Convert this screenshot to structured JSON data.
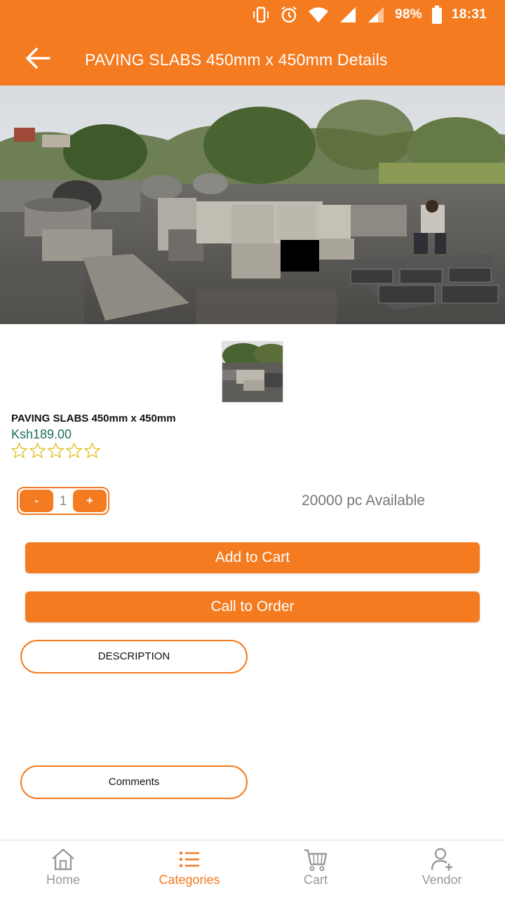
{
  "status_bar": {
    "battery": "98%",
    "time": "18:31"
  },
  "app_bar": {
    "title": "PAVING SLABS 450mm x 450mm Details"
  },
  "product": {
    "name": "PAVING SLABS 450mm x 450mm",
    "price": "Ksh189.00",
    "rating": 0,
    "rating_max": 5
  },
  "quantity": {
    "minus_label": "-",
    "value": "1",
    "plus_label": "+"
  },
  "availability": "20000 pc Available",
  "actions": {
    "add_to_cart": "Add to Cart",
    "call_to_order": "Call to Order",
    "description": "DESCRIPTION",
    "comments": "Comments"
  },
  "bottom_nav": {
    "items": [
      {
        "label": "Home",
        "icon": "home-icon"
      },
      {
        "label": "Categories",
        "icon": "list-icon"
      },
      {
        "label": "Cart",
        "icon": "cart-icon"
      },
      {
        "label": "Vendor",
        "icon": "user-add-icon"
      }
    ],
    "active_index": 1
  },
  "colors": {
    "accent": "#f47b20",
    "price": "#1f6e5c",
    "star_outline": "#e0c020"
  }
}
